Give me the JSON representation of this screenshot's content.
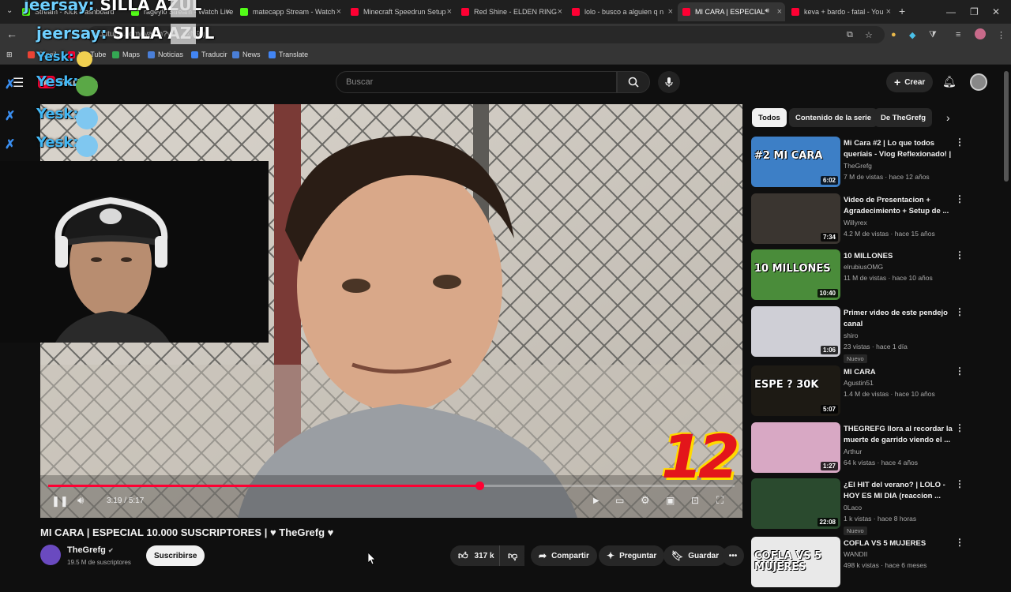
{
  "browser": {
    "tabs": [
      {
        "label": "Stream - Kick Dashboard",
        "color": "#53fc18",
        "active": false
      },
      {
        "label": "rageylo Stream - Watch Live",
        "color": "#53fc18",
        "active": false
      },
      {
        "label": "matecapp Stream - Watch",
        "color": "#53fc18",
        "active": false
      },
      {
        "label": "Minecraft Speedrun Setup",
        "color": "#ff0033",
        "active": false
      },
      {
        "label": "Red Shine - ELDEN RING",
        "color": "#ff0033",
        "active": false
      },
      {
        "label": "lolo - busco a alguien q n",
        "color": "#ff0033",
        "active": false
      },
      {
        "label": "MI CARA | ESPECIAL",
        "color": "#ff0033",
        "active": true
      },
      {
        "label": "keva + bardo - fatal - You",
        "color": "#ff0033",
        "active": false
      }
    ],
    "url": "youtube.com/watch?v=...ckN9g",
    "bookmarks": [
      "Gmail",
      "YouTube",
      "Maps",
      "Noticias",
      "Traducir",
      "News",
      "Translate"
    ]
  },
  "chat_overlay": {
    "messages": [
      {
        "name": "jeersay:",
        "text": "SILLA AZUL"
      },
      {
        "name": "jeersay:",
        "text": "SILLA AZUL"
      },
      {
        "name": "Yesk:",
        "text": ""
      },
      {
        "name": "Yesk:",
        "text": ""
      },
      {
        "name": "Yesk:",
        "text": ""
      },
      {
        "name": "Yesk:",
        "text": ""
      }
    ]
  },
  "youtube": {
    "logo": "YouTube",
    "search_placeholder": "Buscar",
    "create_label": "Crear",
    "player": {
      "time_current": "3:19",
      "time_separator": "/",
      "time_total": "5:17",
      "progress": 0.628,
      "overlay_number": "12"
    },
    "video": {
      "title": "MI CARA | ESPECIAL 10.000 SUSCRIPTORES | ♥ TheGrefg ♥",
      "channel": "TheGrefg",
      "subscribers": "19.5 M de suscriptores",
      "subscribe_label": "Suscribirse",
      "likes": "317 k",
      "share_label": "Compartir",
      "ask_label": "Preguntar",
      "save_label": "Guardar"
    },
    "chips": [
      "Todos",
      "Contenido de la serie",
      "De TheGrefg"
    ],
    "recommendations": [
      {
        "title": "Mi Cara #2 | Lo que todos queríais - Vlog Reflexionado! | ...",
        "channel": "TheGrefg",
        "meta": "7 M de vistas · hace 12 años",
        "duration": "6:02",
        "badge": "",
        "thumb": "#3d7fc6",
        "thumb_text": "#2 MI CARA"
      },
      {
        "title": "Video de Presentacion + Agradecimiento + Setup de ...",
        "channel": "Willyrex",
        "meta": "4.2 M de vistas · hace 15 años",
        "duration": "7:34",
        "badge": "",
        "thumb": "#3a3530",
        "thumb_text": ""
      },
      {
        "title": "10 MILLONES",
        "channel": "elrubiusOMG",
        "meta": "11 M de vistas · hace 10 años",
        "duration": "10:40",
        "badge": "",
        "thumb": "#4a8c3a",
        "thumb_text": "10 MILLONES"
      },
      {
        "title": "Primer video de este pendejo canal",
        "channel": "shiro",
        "meta": "23 vistas · hace 1 día",
        "duration": "1:06",
        "badge": "Nuevo",
        "thumb": "#cfcfd6",
        "thumb_text": ""
      },
      {
        "title": "MI CARA",
        "channel": "Agustin51",
        "meta": "1.4 M de vistas · hace 10 años",
        "duration": "5:07",
        "badge": "",
        "thumb": "#1d1a14",
        "thumb_text": "ESPE ? 30K"
      },
      {
        "title": "THEGREFG llora al recordar la muerte de garrido viendo el ...",
        "channel": "Arthur",
        "meta": "64 k vistas · hace 4 años",
        "duration": "1:27",
        "badge": "",
        "thumb": "#d8a8c4",
        "thumb_text": ""
      },
      {
        "title": "¿El HIT del verano? | LOLO - HOY ES MI DIA (reaccion ...",
        "channel": "0Laco",
        "meta": "1 k vistas · hace 8 horas",
        "duration": "22:08",
        "badge": "Nuevo",
        "thumb": "#2a4a2e",
        "thumb_text": ""
      },
      {
        "title": "COFLA VS 5 MUJERES",
        "channel": "WANDII",
        "meta": "498 k vistas · hace 6 meses",
        "duration": "",
        "badge": "",
        "thumb": "#e9e9e9",
        "thumb_text": "COFLA VS 5 MUJERES"
      }
    ]
  }
}
